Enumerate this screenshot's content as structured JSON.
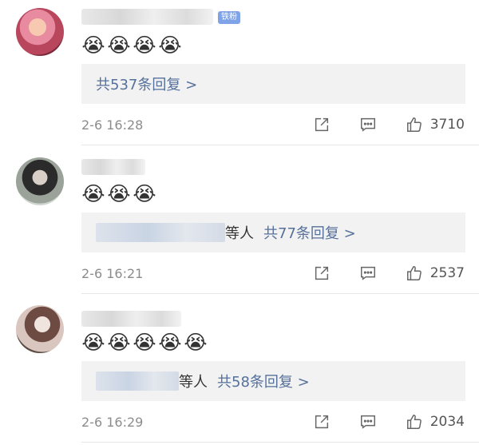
{
  "comments": [
    {
      "badge": "铁粉",
      "emojis": [
        "😭",
        "😭",
        "😭",
        "😭"
      ],
      "reply_by": "",
      "reply_link": "共537条回复 >",
      "time": "2-6 16:28",
      "likes": "3710"
    },
    {
      "badge": "",
      "emojis": [
        "😭",
        "😭",
        "😭"
      ],
      "reply_by": "等人",
      "reply_link": "共77条回复 >",
      "time": "2-6 16:21",
      "likes": "2537"
    },
    {
      "badge": "",
      "emojis": [
        "😭",
        "😭",
        "😭",
        "😭",
        "😭"
      ],
      "reply_by": "等人",
      "reply_link": "共58条回复 >",
      "time": "2-6 16:29",
      "likes": "2034"
    }
  ],
  "icons": {
    "share": "share-icon",
    "comment": "comment-icon",
    "like": "thumbs-up-icon"
  }
}
